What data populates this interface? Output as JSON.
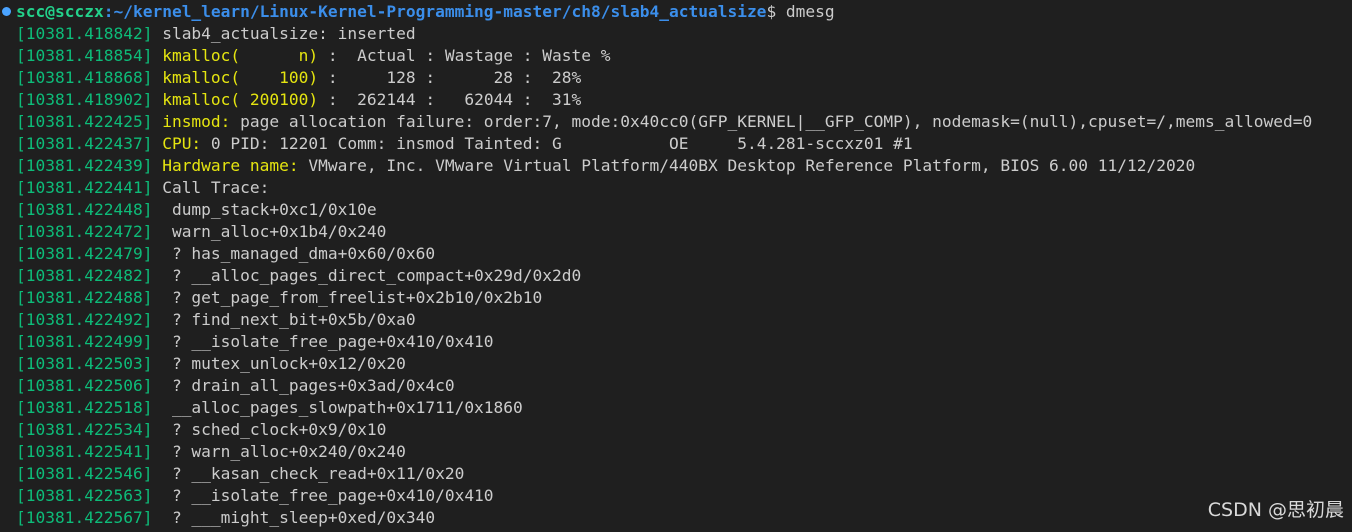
{
  "prompt": {
    "user_host": "scc@scczx",
    "separator": ":",
    "path": "~/kernel_learn/Linux-Kernel-Programming-master/ch8/slab4_actualsize",
    "symbol": "$",
    "command": " dmesg"
  },
  "lines": [
    {
      "ts": "[10381.418842]",
      "hl": "",
      "text": " slab4_actualsize: inserted"
    },
    {
      "ts": "[10381.418854]",
      "hl": " kmalloc(      n)",
      "text": " :  Actual : Wastage : Waste %"
    },
    {
      "ts": "[10381.418868]",
      "hl": " kmalloc(    100)",
      "text": " :     128 :      28 :  28%"
    },
    {
      "ts": "[10381.418902]",
      "hl": " kmalloc( 200100)",
      "text": " :  262144 :   62044 :  31%"
    },
    {
      "ts": "[10381.422425]",
      "hl": " insmod:",
      "text": " page allocation failure: order:7, mode:0x40cc0(GFP_KERNEL|__GFP_COMP), nodemask=(null),cpuset=/,mems_allowed=0"
    },
    {
      "ts": "[10381.422437]",
      "hl": " CPU:",
      "text": " 0 PID: 12201 Comm: insmod Tainted: G           OE     5.4.281-sccxz01 #1"
    },
    {
      "ts": "[10381.422439]",
      "hl": " Hardware name:",
      "text": " VMware, Inc. VMware Virtual Platform/440BX Desktop Reference Platform, BIOS 6.00 11/12/2020"
    },
    {
      "ts": "[10381.422441]",
      "hl": "",
      "text": " Call Trace:"
    },
    {
      "ts": "[10381.422448]",
      "hl": "",
      "text": "  dump_stack+0xc1/0x10e"
    },
    {
      "ts": "[10381.422472]",
      "hl": "",
      "text": "  warn_alloc+0x1b4/0x240"
    },
    {
      "ts": "[10381.422479]",
      "hl": "",
      "text": "  ? has_managed_dma+0x60/0x60"
    },
    {
      "ts": "[10381.422482]",
      "hl": "",
      "text": "  ? __alloc_pages_direct_compact+0x29d/0x2d0"
    },
    {
      "ts": "[10381.422488]",
      "hl": "",
      "text": "  ? get_page_from_freelist+0x2b10/0x2b10"
    },
    {
      "ts": "[10381.422492]",
      "hl": "",
      "text": "  ? find_next_bit+0x5b/0xa0"
    },
    {
      "ts": "[10381.422499]",
      "hl": "",
      "text": "  ? __isolate_free_page+0x410/0x410"
    },
    {
      "ts": "[10381.422503]",
      "hl": "",
      "text": "  ? mutex_unlock+0x12/0x20"
    },
    {
      "ts": "[10381.422506]",
      "hl": "",
      "text": "  ? drain_all_pages+0x3ad/0x4c0"
    },
    {
      "ts": "[10381.422518]",
      "hl": "",
      "text": "  __alloc_pages_slowpath+0x1711/0x1860"
    },
    {
      "ts": "[10381.422534]",
      "hl": "",
      "text": "  ? sched_clock+0x9/0x10"
    },
    {
      "ts": "[10381.422541]",
      "hl": "",
      "text": "  ? warn_alloc+0x240/0x240"
    },
    {
      "ts": "[10381.422546]",
      "hl": "",
      "text": "  ? __kasan_check_read+0x11/0x20"
    },
    {
      "ts": "[10381.422563]",
      "hl": "",
      "text": "  ? __isolate_free_page+0x410/0x410"
    },
    {
      "ts": "[10381.422567]",
      "hl": "",
      "text": "  ? ___might_sleep+0xed/0x340"
    }
  ],
  "watermark": "CSDN @思初晨",
  "colors": {
    "background": "#1f1f1f",
    "timestamp": "#0dbc79",
    "highlight": "#e5e510",
    "user_host": "#23d18b",
    "path": "#3b8eea",
    "text": "#cccccc"
  }
}
